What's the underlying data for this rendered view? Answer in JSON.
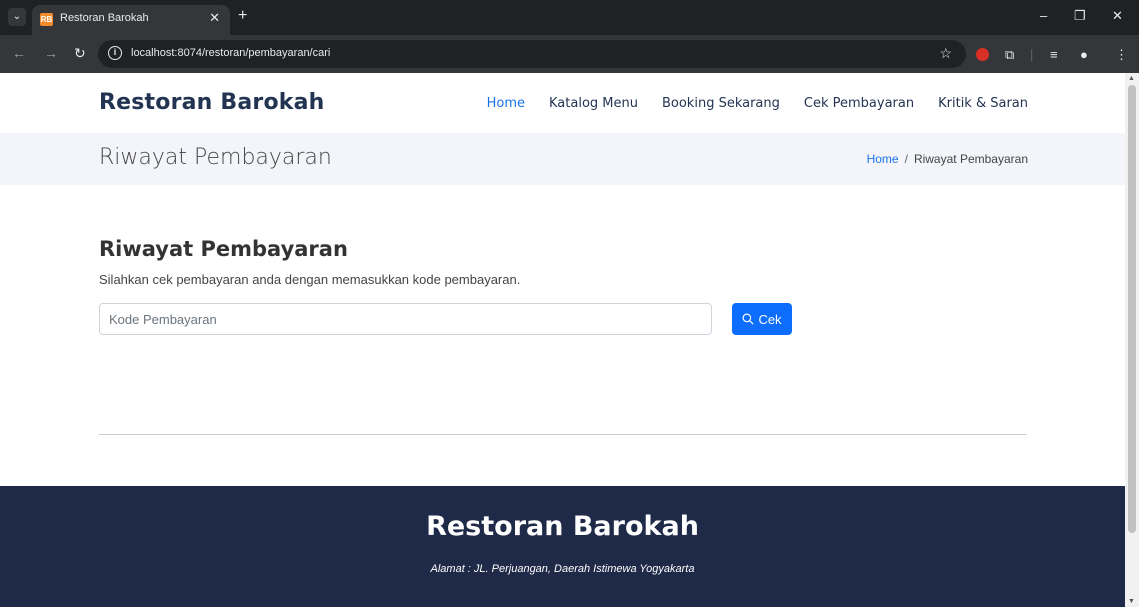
{
  "browser": {
    "tab_title": "Restoran Barokah",
    "tab_favicon_text": "RB",
    "url": "localhost:8074/restoran/pembayaran/cari"
  },
  "header": {
    "brand": "Restoran Barokah",
    "nav": [
      {
        "label": "Home",
        "active": true
      },
      {
        "label": "Katalog Menu",
        "active": false
      },
      {
        "label": "Booking Sekarang",
        "active": false
      },
      {
        "label": "Cek Pembayaran",
        "active": false
      },
      {
        "label": "Kritik & Saran",
        "active": false
      }
    ]
  },
  "breadcrumbs": {
    "title": "Riwayat Pembayaran",
    "home": "Home",
    "separator": "/",
    "current": "Riwayat Pembayaran"
  },
  "main": {
    "title": "Riwayat Pembayaran",
    "description": "Silahkan cek pembayaran anda dengan memasukkan kode pembayaran.",
    "input_placeholder": "Kode Pembayaran",
    "button_label": "Cek"
  },
  "footer": {
    "brand": "Restoran Barokah",
    "address": "Alamat : JL. Perjuangan, Daerah Istimewa Yogyakarta"
  },
  "colors": {
    "brand_navy": "#233452",
    "link_blue": "#1a73e8",
    "button_blue": "#0d6efd",
    "footer_bg": "#1f2a48"
  }
}
